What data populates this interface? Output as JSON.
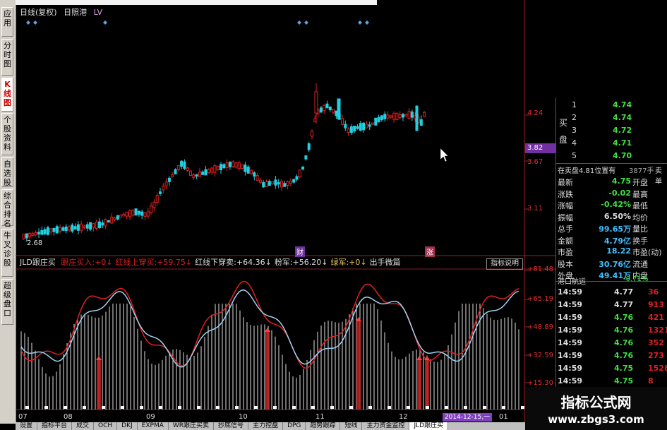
{
  "left_tabs": [
    {
      "label": "应用",
      "active": false
    },
    {
      "label": "分时图",
      "active": false
    },
    {
      "label": "K线图",
      "active": true
    },
    {
      "label": "个股资料",
      "active": false
    },
    {
      "label": "自选股",
      "active": false
    },
    {
      "label": "综合排名",
      "active": false
    },
    {
      "label": "牛叉诊股",
      "active": false
    },
    {
      "label": "超级盘口",
      "active": false
    }
  ],
  "chart_header": {
    "period": "日线(复权)",
    "name": "日照港",
    "tag": "LV"
  },
  "price_axis": {
    "labels": [
      "4.24",
      "3.82",
      "3.67",
      "3.11",
      "2.68"
    ]
  },
  "price_chart_markers": [
    "财",
    "涨"
  ],
  "indicator": {
    "name": "JLD跟庄买",
    "items": [
      {
        "label": "跟庄买入:",
        "value": "+0↓",
        "color": "#e02020"
      },
      {
        "label": "红线上穿买:",
        "value": "+59.75↓",
        "color": "#e02020"
      },
      {
        "label": "红线下穿卖:",
        "value": "+64.36↓",
        "color": "#dddddd"
      },
      {
        "label": "粉军:",
        "value": "+56.20↓",
        "color": "#dddddd"
      },
      {
        "label": "绿军:",
        "value": "+0↓",
        "color": "#e0c060"
      },
      {
        "label": "出手微篇",
        "value": "",
        "color": "#dddddd"
      }
    ],
    "button": "指标说明",
    "axis": [
      "+81.48",
      "+65.19",
      "+48.89",
      "+32.59",
      "+15.30"
    ]
  },
  "x_axis_labels": [
    "07",
    "08",
    "09",
    "10",
    "11",
    "12",
    "01"
  ],
  "date_box": "2014-12-15,一",
  "right_panel": {
    "buy_label": "买盘",
    "bids": [
      {
        "lvl": "1",
        "price": "4.74"
      },
      {
        "lvl": "2",
        "price": "4.74"
      },
      {
        "lvl": "3",
        "price": "4.72"
      },
      {
        "lvl": "4",
        "price": "4.71"
      },
      {
        "lvl": "5",
        "price": "4.70"
      }
    ],
    "instatus": "在卖盘4.81位置有",
    "instatus_vol": "3877手",
    "instatus_tail": "卖单",
    "stats": [
      {
        "l": "最新",
        "v": "4.75",
        "l2": "开盘"
      },
      {
        "l": "涨跌",
        "v": "-0.02",
        "l2": "最高"
      },
      {
        "l": "涨幅",
        "v": "-0.42%",
        "l2": "最低"
      },
      {
        "l": "振幅",
        "v": "6.50%",
        "l2": "均价"
      },
      {
        "l": "总手",
        "v": "99.65万",
        "l2": "量比"
      },
      {
        "l": "金额",
        "v": "4.79亿",
        "l2": "换手"
      },
      {
        "l": "市盈",
        "v": "18.22",
        "l2": "市盈(动)"
      },
      {
        "l": "股本",
        "v": "30.76亿",
        "l2": "流通"
      },
      {
        "l": "外盘",
        "v": "49.41万",
        "l2": "内盘"
      }
    ],
    "sector": "港口航运",
    "sector_change": "-0.71%",
    "ticks": [
      {
        "t": "14:59",
        "p": "4.77",
        "v": "36"
      },
      {
        "t": "14:59",
        "p": "4.77",
        "v": "913"
      },
      {
        "t": "14:59",
        "p": "4.76",
        "v": "421"
      },
      {
        "t": "14:59",
        "p": "4.76",
        "v": "1321"
      },
      {
        "t": "14:59",
        "p": "4.76",
        "v": "352"
      },
      {
        "t": "14:59",
        "p": "4.76",
        "v": "273"
      },
      {
        "t": "14:59",
        "p": "4.75",
        "v": "1528"
      },
      {
        "t": "14:59",
        "p": "4.75",
        "v": "8"
      }
    ]
  },
  "watermark": {
    "line1": "指标公式网",
    "line2": "www.zbgs3.com"
  },
  "bottom_tabs": [
    "设置",
    "指标平台",
    "成交",
    "OCH",
    "DKJ",
    "EXPMA",
    "WR跟庄买卖",
    "抄底信号",
    "主力控盘",
    "DPG",
    "趋势跟踪",
    "短线",
    "主力资金监控",
    "JLD跟庄买"
  ],
  "colors": {
    "up": "#e02020",
    "down": "#20d0e0",
    "green": "#40e040",
    "axis": "#e03030"
  }
}
